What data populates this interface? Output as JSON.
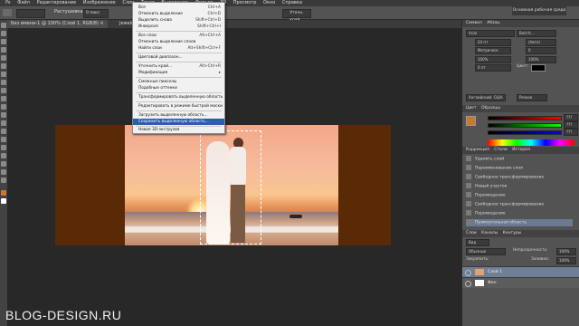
{
  "menubar": {
    "items": [
      "Ps",
      "Файл",
      "Редактирование",
      "Изображение",
      "Слои",
      "Текст",
      "Выделение",
      "Фильтр",
      "3D",
      "Просмотр",
      "Окно",
      "Справка"
    ]
  },
  "options": {
    "tool_label": "Растушевка:",
    "feather_value": "0 пикс",
    "refine_label": "Уточн. край..."
  },
  "document_tabs": [
    "Без имени-1 @ 100% (Слой 1, RGB/8) ×",
    "Jewelried by fashion.jpg"
  ],
  "select_menu": {
    "items": [
      {
        "label": "Все",
        "shortcut": "Ctrl+A"
      },
      {
        "label": "Отменить выделение",
        "shortcut": "Ctrl+D"
      },
      {
        "label": "Выделить снова",
        "shortcut": "Shift+Ctrl+D"
      },
      {
        "label": "Инверсия",
        "shortcut": "Shift+Ctrl+I"
      },
      {
        "label": "Все слои",
        "shortcut": "Alt+Ctrl+A"
      },
      {
        "label": "Отменить выделение слоев",
        "shortcut": ""
      },
      {
        "label": "Найти слои",
        "shortcut": "Alt+Shift+Ctrl+F"
      },
      {
        "label": "Цветовой диапазон...",
        "shortcut": ""
      },
      {
        "label": "Уточнить край...",
        "shortcut": "Alt+Ctrl+R"
      },
      {
        "label": "Модификация",
        "shortcut": "▸"
      },
      {
        "label": "Смежные пикселы",
        "shortcut": ""
      },
      {
        "label": "Подобные оттенки",
        "shortcut": ""
      },
      {
        "label": "Трансформировать выделенную область",
        "shortcut": ""
      },
      {
        "label": "Редактировать в режиме быстрой маски",
        "shortcut": ""
      },
      {
        "label": "Загрузить выделенную область...",
        "shortcut": ""
      },
      {
        "label": "Сохранить выделенную область...",
        "shortcut": ""
      },
      {
        "label": "Новая 3D-экструзия",
        "shortcut": ""
      }
    ]
  },
  "workspace": {
    "label": "Основная рабочая среда"
  },
  "character_panel": {
    "tabs": [
      "Символ",
      "Абзац"
    ],
    "font": "Arial",
    "style": "Bold It...",
    "size": "24 пт",
    "leading": "(Авто)",
    "kerning": "Метрическ",
    "tracking": "0",
    "scale_v": "100%",
    "scale_h": "100%",
    "baseline": "0 пт",
    "color_label": "Цвет:",
    "aa_label": "Английский: США",
    "aa_value": "Резкое"
  },
  "color_panel": {
    "tabs": [
      "Цвет",
      "Образцы"
    ],
    "r": "???",
    "g": "???",
    "b": "???"
  },
  "history_panel": {
    "tabs": [
      "Коррекция",
      "Стили",
      "История"
    ],
    "items": [
      "Удалить слой",
      "Переименование слоя",
      "Свободное трансформирование",
      "Новый участок",
      "Перемещение",
      "Свободное трансформирование",
      "Перемещение",
      "Прямоугольная область"
    ],
    "selected_index": 7
  },
  "layers_panel": {
    "tabs": [
      "Слои",
      "Каналы",
      "Контуры"
    ],
    "kind_label": "Вид",
    "blend_mode": "Обычные",
    "opacity_label": "Непрозрачность:",
    "opacity_value": "100%",
    "lock_label": "Закрепить:",
    "fill_label": "Заливка:",
    "fill_value": "100%",
    "layers": [
      {
        "name": "Слой 1",
        "thumb_color": "#e5a070",
        "selected": true
      },
      {
        "name": "Фон",
        "thumb_color": "#ffffff",
        "selected": false
      }
    ]
  },
  "watermark": "BLOG-DESIGN.RU",
  "colors": {
    "selection_highlight": "#2d5ea8",
    "doc_background": "#5a2906"
  }
}
